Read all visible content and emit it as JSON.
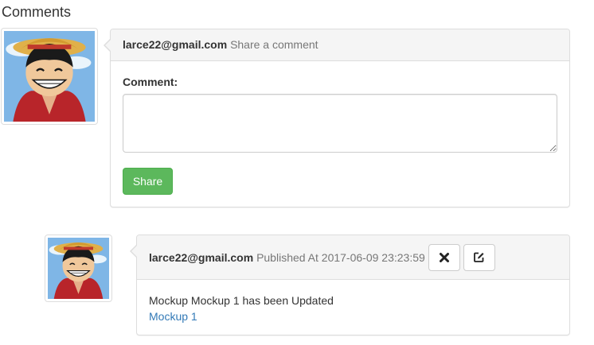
{
  "section": {
    "title": "Comments"
  },
  "new_comment": {
    "user": "larce22@gmail.com",
    "heading_note": "Share a comment",
    "comment_label": "Comment:",
    "comment_value": "",
    "share_label": "Share",
    "share_color": "#5cb85c"
  },
  "comments": [
    {
      "user": "larce22@gmail.com",
      "published_label": "Published At 2017-06-09 23:23:59",
      "delete_icon": "times-icon",
      "edit_icon": "edit-icon",
      "text": "Mockup Mockup 1 has been Updated",
      "link_text": "Mockup 1",
      "link_color": "#337ab7"
    }
  ]
}
